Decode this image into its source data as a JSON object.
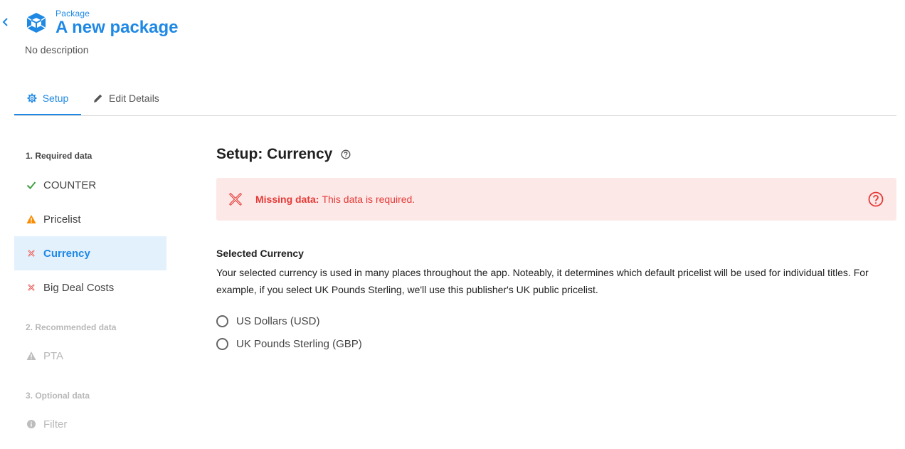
{
  "header": {
    "overline": "Package",
    "title": "A new package",
    "description": "No description"
  },
  "tabs": [
    {
      "label": "Setup",
      "icon": "gear-icon",
      "active": true
    },
    {
      "label": "Edit Details",
      "icon": "pencil-icon",
      "active": false
    }
  ],
  "sidebar": {
    "sections": [
      {
        "heading": "1. Required data",
        "items": [
          {
            "label": "COUNTER",
            "status": "complete",
            "icon": "check-icon"
          },
          {
            "label": "Pricelist",
            "status": "warning",
            "icon": "warning-icon"
          },
          {
            "label": "Currency",
            "status": "missing",
            "icon": "x-icon",
            "active": true
          },
          {
            "label": "Big Deal Costs",
            "status": "missing",
            "icon": "x-icon"
          }
        ]
      },
      {
        "heading": "2. Recommended data",
        "items": [
          {
            "label": "PTA",
            "status": "disabled",
            "icon": "warning-icon"
          }
        ]
      },
      {
        "heading": "3. Optional data",
        "items": [
          {
            "label": "Filter",
            "status": "disabled",
            "icon": "info-icon"
          }
        ]
      }
    ]
  },
  "main": {
    "title": "Setup: Currency",
    "alert": {
      "strong": "Missing data:",
      "text": "This data is required."
    },
    "section_title": "Selected Currency",
    "section_body": "Your selected currency is used in many places throughout the app. Noteably, it determines which default pricelist will be used for individual titles. For example, if you select UK Pounds Sterling, we'll use this publisher's UK public pricelist.",
    "options": [
      {
        "label": "US Dollars (USD)",
        "checked": false
      },
      {
        "label": "UK Pounds Sterling (GBP)",
        "checked": false
      }
    ]
  },
  "colors": {
    "accent": "#1e88e5",
    "error": "#e53935",
    "error_bg": "#fde8e8",
    "success": "#43a047",
    "warning": "#fb8c00",
    "active_bg": "#e3f1fd"
  }
}
